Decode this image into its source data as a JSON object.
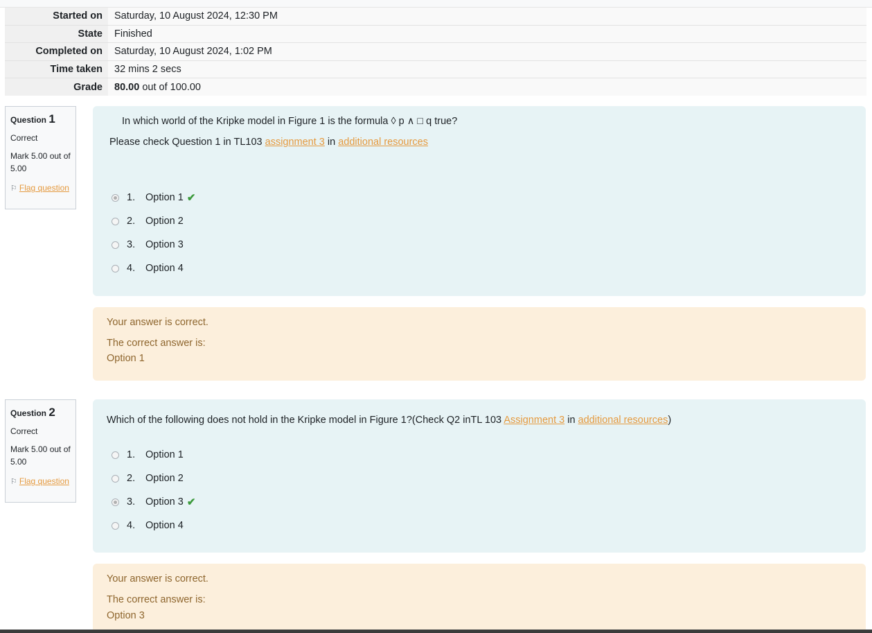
{
  "summary": {
    "rows": [
      {
        "label": "Started on",
        "value": "Saturday, 10 August 2024, 12:30 PM"
      },
      {
        "label": "State",
        "value": "Finished"
      },
      {
        "label": "Completed on",
        "value": "Saturday, 10 August 2024, 1:02 PM"
      },
      {
        "label": "Time taken",
        "value": "32 mins 2 secs"
      }
    ],
    "grade_label": "Grade",
    "grade_value": "80.00",
    "grade_suffix": " out of 100.00"
  },
  "questions": [
    {
      "word": "Question",
      "number": "1",
      "state": "Correct",
      "mark": "Mark 5.00 out of 5.00",
      "flag": "Flag question",
      "text_line1": "In which world of the Kripke model in Figure 1 is the formula ◊ p ∧ □ q  true?",
      "text_line2_prefix": "Please check Question 1 in TL103 ",
      "link1": "assignment 3",
      "mid": " in ",
      "link2": "additional resources",
      "answers": [
        {
          "num": "1.",
          "label": "Option 1"
        },
        {
          "num": "2.",
          "label": "Option 2"
        },
        {
          "num": "3.",
          "label": "Option 3"
        },
        {
          "num": "4.",
          "label": "Option 4"
        }
      ],
      "feedback": "Your answer is correct.",
      "right_answer_label": "The correct answer is:",
      "right_answer": "Option 1"
    },
    {
      "word": "Question",
      "number": "2",
      "state": "Correct",
      "mark": "Mark 5.00 out of 5.00",
      "flag": "Flag question",
      "text_prefix": "Which of the following does not hold in the Kripke model in Figure 1?(Check Q2 inTL 103  ",
      "link1": "Assignment 3",
      "mid": " in ",
      "link2": "additional resources",
      "suffix": ")",
      "answers": [
        {
          "num": "1.",
          "label": "Option 1"
        },
        {
          "num": "2.",
          "label": "Option 2"
        },
        {
          "num": "3.",
          "label": "Option 3"
        },
        {
          "num": "4.",
          "label": "Option 4"
        }
      ],
      "feedback": "Your answer is correct.",
      "right_answer_label": "The correct answer is:",
      "right_answer": "Option 3"
    }
  ],
  "colors": {
    "formulation_bg": "#e7f3f5",
    "outcome_bg": "#fcefdc",
    "outcome_text": "#8e662e",
    "link": "#e59a3f",
    "tick": "#3c9a3c"
  }
}
